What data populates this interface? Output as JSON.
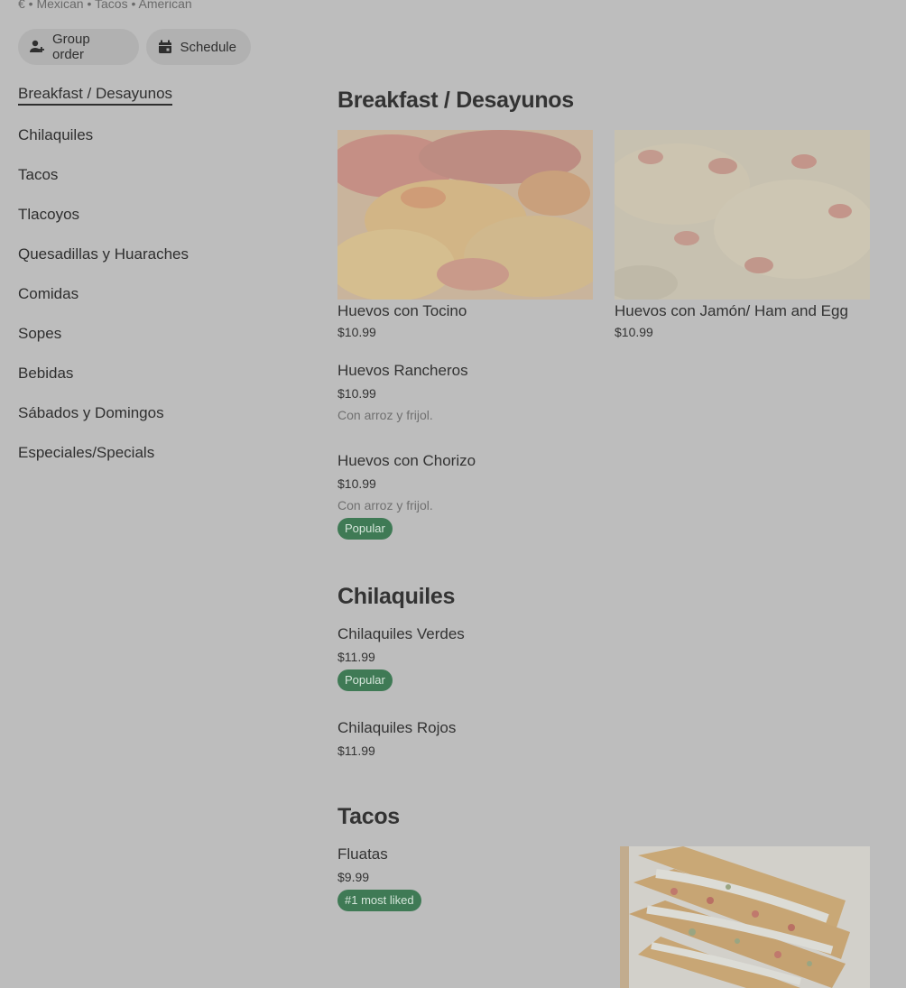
{
  "store": {
    "meta": "€ • Mexican • Tacos • American"
  },
  "actions": {
    "group_order": "Group order",
    "schedule": "Schedule"
  },
  "nav": {
    "items": [
      {
        "label": "Breakfast / Desayunos",
        "active": true
      },
      {
        "label": "Chilaquiles"
      },
      {
        "label": "Tacos"
      },
      {
        "label": "Tlacoyos"
      },
      {
        "label": "Quesadillas y Huaraches"
      },
      {
        "label": "Comidas"
      },
      {
        "label": "Sopes"
      },
      {
        "label": "Bebidas"
      },
      {
        "label": "Sábados y Domingos"
      },
      {
        "label": "Especiales/Specials"
      }
    ]
  },
  "sections": {
    "breakfast": {
      "title": "Breakfast / Desayunos",
      "items": [
        {
          "name": "Huevos con Tocino",
          "price": "$10.99",
          "image": "bacon-eggs"
        },
        {
          "name": "Huevos con Jamón/ Ham and Egg",
          "price": "$10.99",
          "image": "ham-eggs"
        },
        {
          "name": "Huevos Rancheros",
          "price": "$10.99",
          "desc": "Con arroz y frijol."
        },
        {
          "name": "Huevos con Chorizo",
          "price": "$10.99",
          "desc": "Con arroz y frijol.",
          "badge": "Popular"
        }
      ]
    },
    "chilaquiles": {
      "title": "Chilaquiles",
      "items": [
        {
          "name": "Chilaquiles Verdes",
          "price": "$11.99",
          "badge": "Popular"
        },
        {
          "name": "Chilaquiles Rojos",
          "price": "$11.99"
        }
      ]
    },
    "tacos": {
      "title": "Tacos",
      "items": [
        {
          "name": "Fluatas",
          "price": "$9.99",
          "badge": "#1 most liked",
          "image": "flautas"
        }
      ]
    }
  },
  "colors": {
    "overlay_bg": "#bdbdbd",
    "badge_green": "#3f7a55"
  }
}
